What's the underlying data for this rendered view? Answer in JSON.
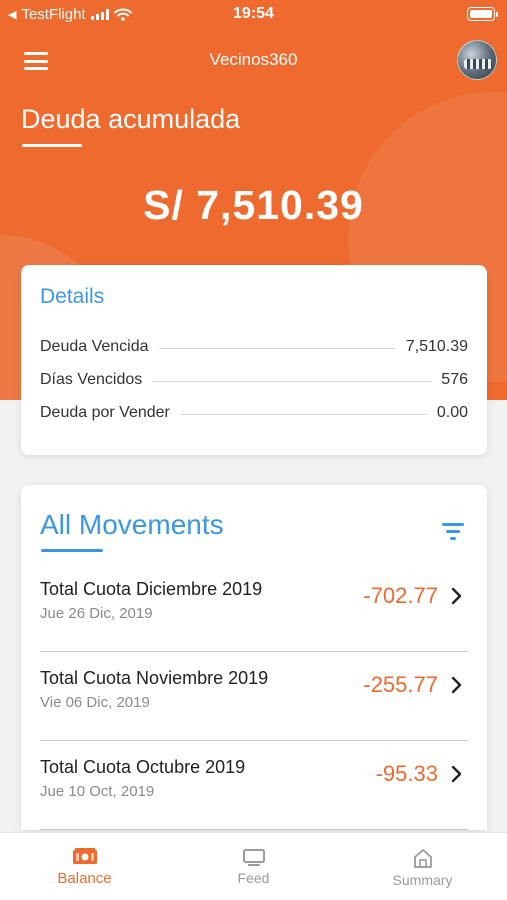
{
  "status_bar": {
    "back_glyph": "◀",
    "carrier": "TestFlight",
    "time": "19:54"
  },
  "nav": {
    "title": "Vecinos360",
    "menu_icon": "hamburger-icon",
    "avatar_icon": "user-avatar"
  },
  "hero": {
    "title": "Deuda acumulada",
    "amount": "S/ 7,510.39"
  },
  "details": {
    "title": "Details",
    "rows": [
      {
        "label": "Deuda Vencida",
        "value": "7,510.39"
      },
      {
        "label": "Días Vencidos",
        "value": "576"
      },
      {
        "label": "Deuda por Vender",
        "value": "0.00"
      }
    ]
  },
  "movements": {
    "title": "All Movements",
    "filter_icon": "filter-icon",
    "items": [
      {
        "name": "Total Cuota Diciembre 2019",
        "date": "Jue 26 Dic, 2019",
        "amount": "-702.77"
      },
      {
        "name": "Total Cuota Noviembre 2019",
        "date": "Vie 06 Dic, 2019",
        "amount": "-255.77"
      },
      {
        "name": "Total Cuota Octubre 2019",
        "date": "Jue 10 Oct, 2019",
        "amount": "-95.33"
      }
    ]
  },
  "tabbar": {
    "tabs": [
      {
        "label": "Balance",
        "icon": "money-icon",
        "active": true
      },
      {
        "label": "Feed",
        "icon": "card-icon",
        "active": false
      },
      {
        "label": "Summary",
        "icon": "home-icon",
        "active": false
      }
    ]
  },
  "colors": {
    "brand_orange": "#ee6a2f",
    "accent_blue": "#3b97e6",
    "negative_amount": "#ee6a2f"
  }
}
